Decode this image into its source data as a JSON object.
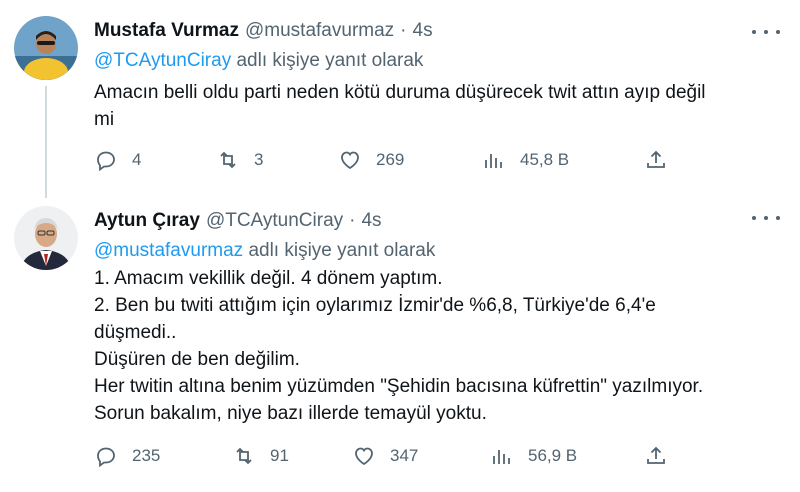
{
  "tweets": [
    {
      "author_name": "Mustafa Vurmaz",
      "handle": "@mustafavurmaz",
      "separator": "·",
      "time": "4s",
      "reply_mention": "@TCAytunCiray",
      "reply_suffix": "adlı kişiye yanıt olarak",
      "lines": [
        "Amacın belli oldu parti neden kötü duruma düşürecek twit attın ayıp değil",
        "mi"
      ],
      "stats": {
        "replies": "4",
        "retweets": "3",
        "likes": "269",
        "views": "45,8 B"
      }
    },
    {
      "author_name": "Aytun Çıray",
      "handle": "@TCAytunCiray",
      "separator": "·",
      "time": "4s",
      "reply_mention": "@mustafavurmaz",
      "reply_suffix": "adlı kişiye yanıt olarak",
      "lines": [
        "1. Amacım vekillik değil. 4 dönem yaptım.",
        "2. Ben bu twiti attığım için oylarımız İzmir'de %6,8, Türkiye'de 6,4'e",
        "düşmedi..",
        "Düşüren de ben değilim.",
        "Her twitin altına benim yüzümden \"Şehidin bacısına küfrettin\" yazılmıyor.",
        "Sorun bakalım, niye bazı illerde temayül yoktu."
      ],
      "stats": {
        "replies": "235",
        "retweets": "91",
        "likes": "347",
        "views": "56,9 B"
      }
    }
  ],
  "icons": {
    "reply": "reply-icon",
    "retweet": "retweet-icon",
    "like": "heart-icon",
    "views": "views-icon",
    "share": "share-icon",
    "more": "more-icon"
  },
  "colors": {
    "link": "#1d9bf0",
    "muted": "#536471",
    "text": "#0f1419",
    "thread_line": "#cfd9de"
  }
}
